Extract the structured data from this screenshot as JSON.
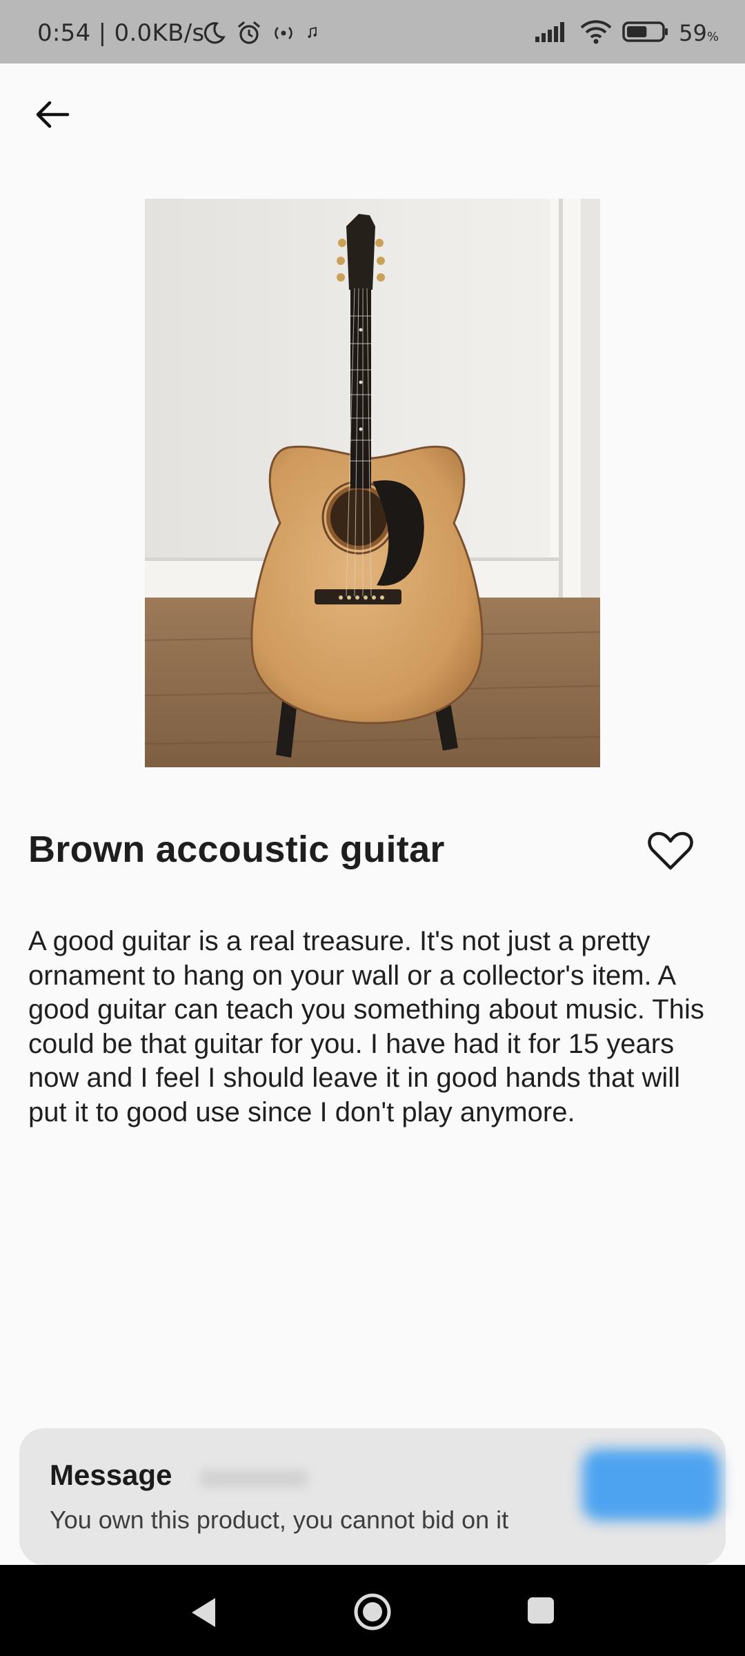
{
  "status_bar": {
    "time": "0:54 | 0.0KB/s",
    "battery_percent": "59",
    "battery_unit": "%",
    "battery_level": 0.59,
    "icons_left": [
      "moon-icon",
      "alarm-icon",
      "hotspot-icon",
      "music-note-icon"
    ],
    "icons_right": [
      "signal-icon",
      "wifi-icon",
      "battery-icon"
    ]
  },
  "product": {
    "title": "Brown accoustic guitar",
    "description": "A good guitar is a real treasure. It's not just a pretty ornament to hang on your wall or a collector's item. A good guitar can teach you something about music. This could be that guitar for you. I have had it for 15 years now and I feel I should leave it in good hands that will put it to good use since I don't play anymore.",
    "image_icon": "guitar-photo",
    "favorite_icon": "heart-outline-icon"
  },
  "message_card": {
    "title": "Message",
    "text": "You own this product, you cannot bid on it"
  },
  "nav": {
    "icons": [
      "back-triangle-icon",
      "home-circle-icon",
      "recents-square-icon"
    ]
  },
  "colors": {
    "status_bar": "#b8b8b8",
    "background": "#fafafa",
    "card": "#e6e6e6",
    "accent": "#4da3f0",
    "nav_bar": "#000000"
  }
}
